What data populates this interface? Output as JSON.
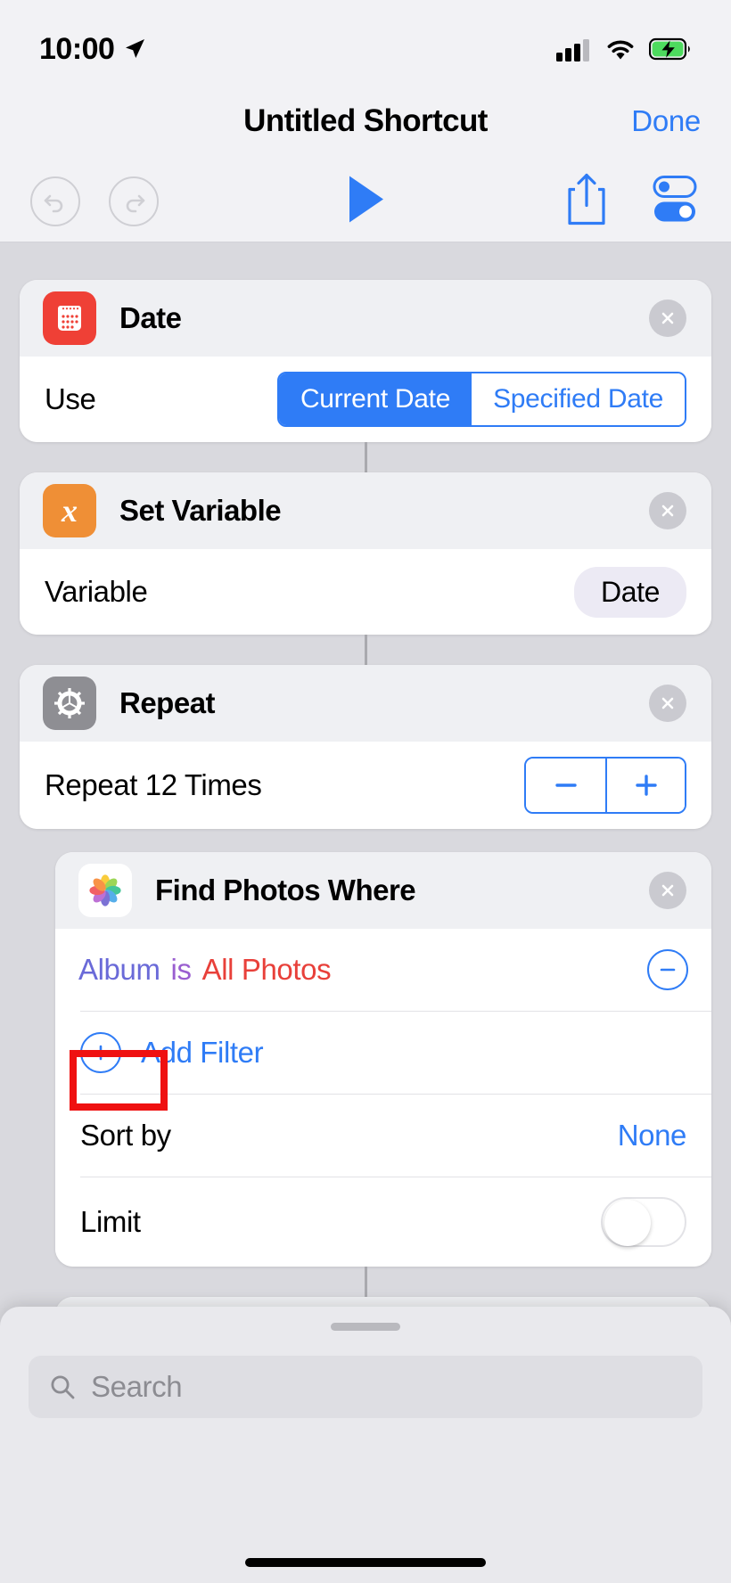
{
  "status_bar": {
    "time": "10:00",
    "location_icon": "location-arrow-icon",
    "cellular_icon": "cellular-bars-icon",
    "wifi_icon": "wifi-icon",
    "battery_icon": "battery-charging-icon"
  },
  "nav": {
    "title": "Untitled Shortcut",
    "done_label": "Done"
  },
  "toolbar": {
    "undo_icon": "undo-icon",
    "redo_icon": "redo-icon",
    "play_icon": "play-icon",
    "share_icon": "share-icon",
    "settings_icon": "settings-toggles-icon"
  },
  "actions": [
    {
      "id": "date",
      "title": "Date",
      "icon": "calendar-icon",
      "icon_color": "#ef4036",
      "rows": [
        {
          "label": "Use",
          "control": "segmented",
          "options": [
            "Current Date",
            "Specified Date"
          ],
          "selected": "Current Date"
        }
      ]
    },
    {
      "id": "set-variable",
      "title": "Set Variable",
      "icon": "variable-x-icon",
      "icon_color": "#ef8f36",
      "rows": [
        {
          "label": "Variable",
          "control": "pill",
          "value": "Date"
        }
      ]
    },
    {
      "id": "repeat",
      "title": "Repeat",
      "icon": "gear-icon",
      "icon_color": "#8e8e93",
      "rows": [
        {
          "label": "Repeat 12 Times",
          "control": "stepper",
          "minus_label": "−",
          "plus_label": "+"
        }
      ]
    },
    {
      "id": "find-photos-where",
      "title": "Find Photos Where",
      "icon": "photos-icon",
      "icon_color": "#ffffff",
      "nested": true,
      "filter": {
        "variable": "Album",
        "operator": "is",
        "value": "All Photos",
        "remove_icon": "minus-circle-icon"
      },
      "add_filter_label": "Add Filter",
      "add_filter_icon": "plus-circle-icon",
      "sort_by_label": "Sort by",
      "sort_by_value": "None",
      "limit_label": "Limit",
      "limit_enabled": false
    }
  ],
  "annotation": {
    "target": "Album",
    "color": "#ef1111"
  },
  "bottom_sheet": {
    "grabber": "sheet-grabber",
    "search_placeholder": "Search",
    "search_icon": "search-icon",
    "search_value": ""
  },
  "colors": {
    "accent_blue": "#2f7cf6",
    "variable_purple": "#6a6ad8",
    "operator_purple": "#9a5fd0",
    "value_red": "#e8403a",
    "annotation_red": "#ef1111"
  }
}
